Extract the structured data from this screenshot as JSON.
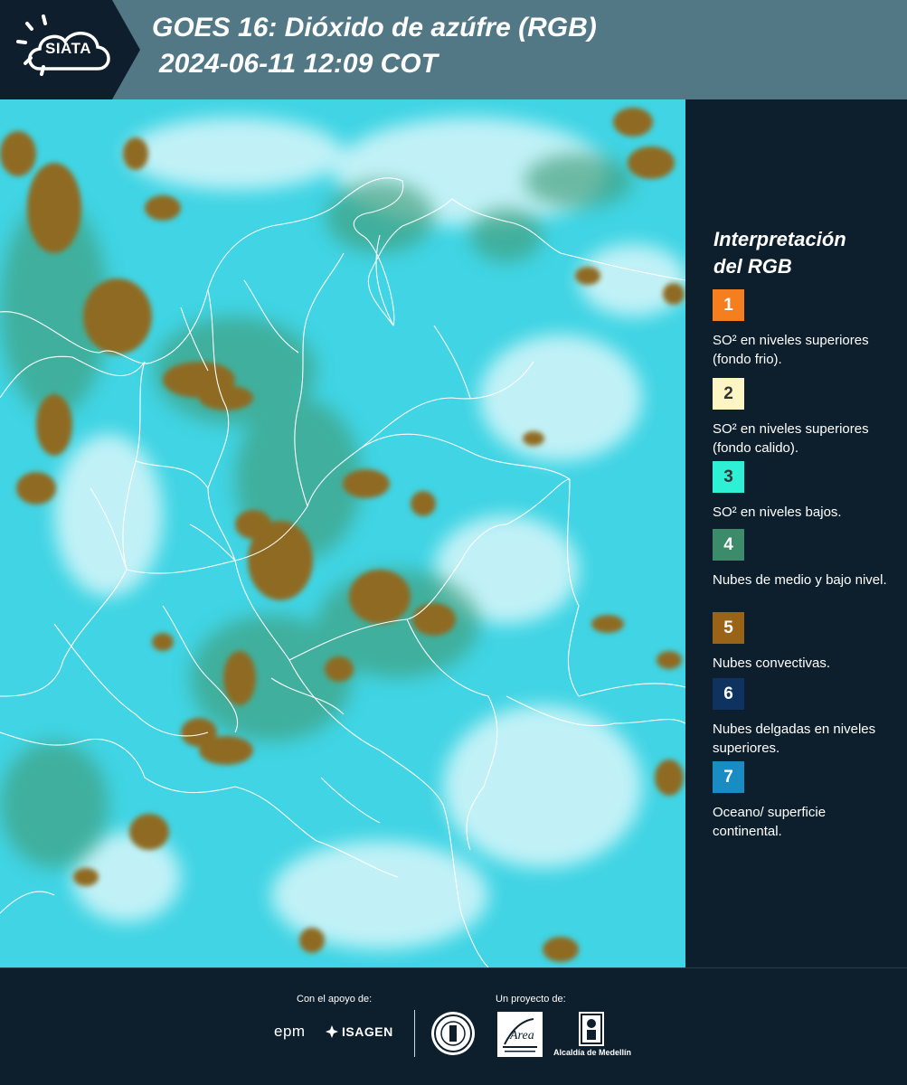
{
  "header": {
    "logo_text": "SIATA",
    "title_line1": "GOES 16: Dióxido de azúfre (RGB)",
    "title_line2": "2024-06-11 12:09 COT",
    "background_color": "#527886"
  },
  "legend": {
    "title_line1": "Interpretación",
    "title_line2": "del RGB",
    "items": [
      {
        "number": "1",
        "color": "#f57f1f",
        "label": "SO² en niveles superiores (fondo frio)."
      },
      {
        "number": "2",
        "color": "#fdf6c4",
        "label": "SO² en niveles superiores (fondo calido)."
      },
      {
        "number": "3",
        "color": "#2ef0d4",
        "label": "SO² en niveles bajos."
      },
      {
        "number": "4",
        "color": "#3c8c6c",
        "label": "Nubes de medio y bajo nivel."
      },
      {
        "number": "5",
        "color": "#9a6418",
        "label": "Nubes convectivas."
      },
      {
        "number": "6",
        "color": "#0e3360",
        "label": "Nubes delgadas en niveles superiores."
      },
      {
        "number": "7",
        "color": "#1a8cc4",
        "label": "Oceano/ superficie continental."
      }
    ]
  },
  "map": {
    "description_colors": {
      "background": "#3fd6e6",
      "cloud_convective": "#8a6a2a",
      "cloud_midlow": "#3c8c6c",
      "clear": "#d9f8fb",
      "borders": "#ffffff"
    }
  },
  "footer": {
    "support_label": "Con el apoyo de:",
    "project_label": "Un proyecto de:",
    "epm": "epm",
    "isagen": "ISAGEN",
    "alcaldia": "Alcaldía de Medellín"
  }
}
